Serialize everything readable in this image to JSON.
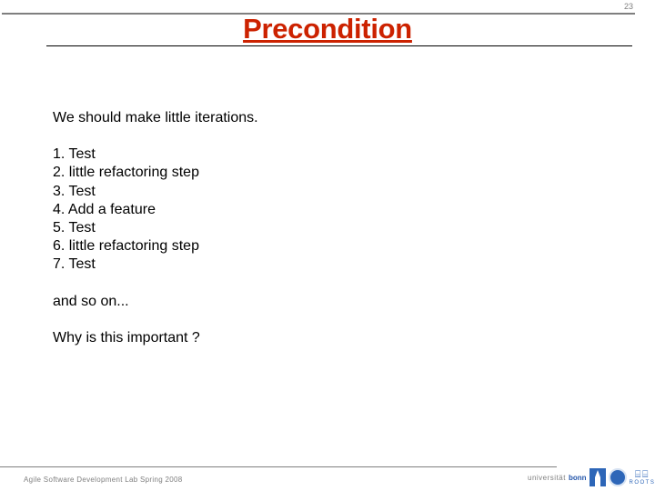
{
  "slide": {
    "page_number": "23",
    "title": "Precondition",
    "intro": "We should make little iterations.",
    "steps": [
      "1. Test",
      "2. little refactoring step",
      "3. Test",
      "4. Add a feature",
      "5. Test",
      "6. little refactoring step",
      "7. Test"
    ],
    "continuation": "and so on...",
    "question": "Why is this important ?"
  },
  "footer": {
    "course": "Agile Software Development Lab Spring 2008",
    "university_prefix": "universität",
    "university_name": "bonn",
    "group_logo": "ROOTS"
  },
  "colors": {
    "title": "#cc2200",
    "rules": "#7f7f7f",
    "logo_blue": "#2d66b8"
  }
}
